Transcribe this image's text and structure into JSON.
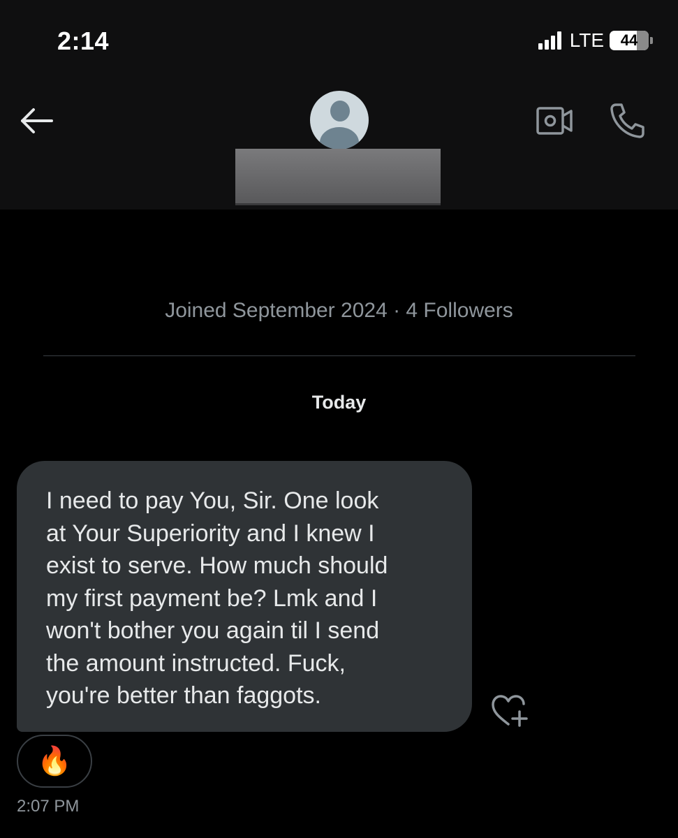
{
  "status_bar": {
    "time": "2:14",
    "network": "LTE",
    "battery": "44"
  },
  "header": {
    "back_icon": "arrow-left-icon",
    "avatar_icon": "default-avatar-icon",
    "video_icon": "video-camera-icon",
    "phone_icon": "phone-icon"
  },
  "profile": {
    "joined": "Joined September 2024 · 4 Followers"
  },
  "conversation": {
    "date_label": "Today",
    "messages": [
      {
        "text": "I need to pay You, Sir. One look\nat Your Superiority and I knew I\nexist to serve. How much should\nmy first payment be? Lmk and I\nwon't bother you again til I send\nthe amount instructed. Fuck,\nyou're better than faggots.",
        "reaction": "🔥",
        "time": "2:07 PM"
      }
    ]
  },
  "colors": {
    "background": "#000000",
    "bubble": "#2f3336",
    "muted_text": "#8f969c",
    "primary_text": "#e7e9ea"
  }
}
